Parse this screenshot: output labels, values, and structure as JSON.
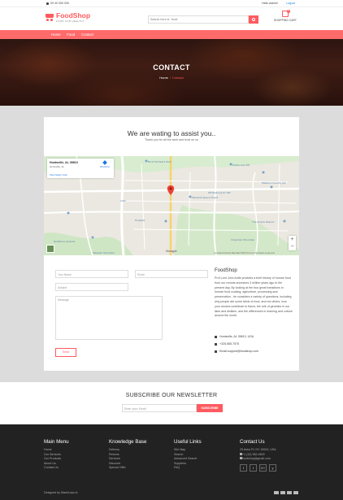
{
  "topbar": {
    "phone": "09 40 000 000",
    "user": "Hello Admin!",
    "logout": "Logout"
  },
  "header": {
    "logo_name": "FoodShop",
    "logo_tagline": "FOOD FOR HEALTHY",
    "search_placeholder": "Search here ie. 'food'",
    "cart_label": "SHOPPING CART",
    "cart_count": "0"
  },
  "nav": {
    "items": [
      "Home",
      "Food",
      "Contact"
    ]
  },
  "hero": {
    "title": "CONTACT",
    "crumb_home": "Home",
    "crumb_sep": "/",
    "crumb_current": "Contact"
  },
  "contact": {
    "title": "We are wating to assist you..",
    "subtitle": "Thank you for all the work and trust on us",
    "map": {
      "place": "Huntsville, AL 35813",
      "place_sub": "Huntsville, AL",
      "larger_map": "View larger map",
      "directions": "Directions",
      "google": "Google",
      "attribution": "Keyboard shortcuts   Map data ©2023   Terms of Use   Report a map error",
      "zoom_in": "+",
      "zoom_out": "−",
      "labels": [
        "Nick Fitcheard Park",
        "Drake Ave SW",
        "Madison County Jail",
        "Marshall Space Flight",
        "Whitesburg Dr SW",
        "UAH",
        "Hospital",
        "The Purple Peanut",
        "Redstone Arsenal",
        "Chapman Mountain",
        "Weeden Mountain"
      ]
    },
    "form": {
      "name_placeholder": "Your Name",
      "email_placeholder": "Email",
      "subject_placeholder": "Subject",
      "message_placeholder": "Message",
      "send_label": "Send"
    },
    "info": {
      "title": "FoodShop",
      "description": "Prof Lord John Antle provides a brief history of human food from our remote ancestors 3 million years ago to the present day. By looking at the four great transitions in human food cooking, agriculture, processing and preservation - he considers a variety of questions, including why people ate some kinds of food, and not others, how your senses contribute to flavor, the role of genetics in our likes and dislikes, and the differences in learning and culture around the world.",
      "address": "Huntsville, AL 35813, USA",
      "phone": "+325.565.7575",
      "email": "Email:support@foodshop.com"
    }
  },
  "newsletter": {
    "title": "SUBSCRIBE OUR NEWSLETTER",
    "placeholder": "Enter your Email",
    "button": "SUBSCRIBE"
  },
  "footer": {
    "main_menu": {
      "title": "Main Menu",
      "links": [
        "Home",
        "Our Services",
        "Our Products",
        "About Us",
        "Contact Us"
      ]
    },
    "knowledge": {
      "title": "Knowledge Base",
      "links": [
        "Delivery",
        "Returns",
        "Services",
        "Discount",
        "Special Offer"
      ]
    },
    "useful": {
      "title": "Useful Links",
      "links": [
        "Site Map",
        "Search",
        "Advanced Search",
        "Suppliers",
        "FAQ"
      ]
    },
    "contact": {
      "title": "Contact Us",
      "address": "25 Astor Pl, NY 10003, USA",
      "phone": "+1 (12) 982-4500",
      "email": "foodshop@gmail.com"
    },
    "socials": [
      "f",
      "t",
      "G+",
      "y"
    ],
    "copyright": "Designed by ManhLeps.io"
  },
  "colors": {
    "accent": "#ff5a5f",
    "nav": "#ff6b6b",
    "footer": "#222222",
    "grey": "#dcdcdc"
  }
}
